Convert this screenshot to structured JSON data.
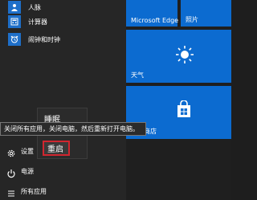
{
  "apps": [
    {
      "label": "人脉",
      "icon": "people-icon"
    },
    {
      "label": "计算器",
      "icon": "calculator-icon"
    },
    {
      "label": "闹钟和时钟",
      "icon": "alarm-clock-icon"
    }
  ],
  "bottom": {
    "settings_label": "设置",
    "power_label": "电源",
    "all_apps_label": "所有应用"
  },
  "power_menu": {
    "sleep_label": "睡眠",
    "restart_label": "重启"
  },
  "tooltip": {
    "text": "关闭所有应用，关闭电脑，然后重新打开电脑。"
  },
  "tiles": {
    "edge_label": "Microsoft Edge",
    "photos_label": "照片",
    "weather_label": "天气",
    "store_label": "应用商店"
  },
  "colors": {
    "tile_blue": "#0c6bd0",
    "highlight_red": "#d0262f",
    "background": "#1e1e1e"
  }
}
